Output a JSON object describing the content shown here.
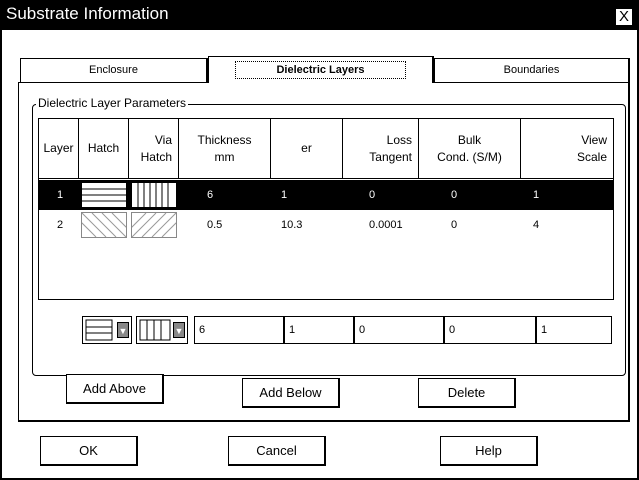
{
  "window": {
    "title": "Substrate Information",
    "close_glyph": "X"
  },
  "tabs": [
    {
      "label": "Enclosure",
      "accesskey": "E"
    },
    {
      "label": "Dielectric Layers",
      "accesskey": "y"
    },
    {
      "label": "Boundaries",
      "accesskey": "B"
    }
  ],
  "group": {
    "label": "Dielectric Layer Parameters"
  },
  "columns": [
    "Layer",
    "Hatch",
    "Via\nHatch",
    "Thickness\nmm",
    "er",
    "Loss\nTangent",
    "Bulk\nCond. (S/M)",
    "View\nScale"
  ],
  "rows": [
    {
      "layer": "1",
      "hatch": "horizontal-lines",
      "via_hatch": "vertical-lines",
      "thickness": "6",
      "er": "1",
      "loss_tangent": "0",
      "bulk_cond": "0",
      "view_scale": "1",
      "selected": true
    },
    {
      "layer": "2",
      "hatch": "diagonal-backslash",
      "via_hatch": "diagonal-slash",
      "thickness": "0.5",
      "er": "10.3",
      "loss_tangent": "0.0001",
      "bulk_cond": "0",
      "view_scale": "4",
      "selected": false
    }
  ],
  "editor": {
    "hatch_icon": "horizontal-lines",
    "via_hatch_icon": "vertical-lines",
    "thickness": "6",
    "er": "1",
    "loss_tangent": "0",
    "bulk_cond": "0",
    "view_scale": "1"
  },
  "buttons": {
    "add_above": "Add Above",
    "add_below": "Add Below",
    "delete": "Delete",
    "ok": "OK",
    "cancel": "Cancel",
    "help": "Help"
  },
  "colors": {
    "title_bg": "#000000",
    "selection_bg": "#000000",
    "dialog_bg": "#ffffff"
  }
}
